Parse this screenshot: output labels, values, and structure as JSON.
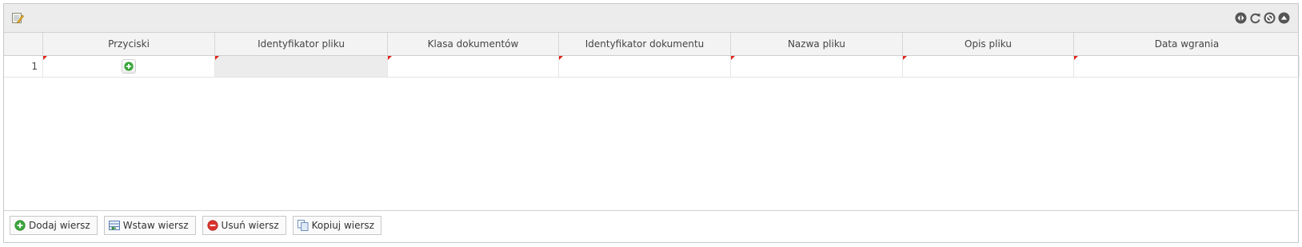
{
  "grid": {
    "columns": [
      "Przyciski",
      "Identyfikator pliku",
      "Klasa dokumentów",
      "Identyfikator dokumentu",
      "Nazwa pliku",
      "Opis pliku",
      "Data wgrania"
    ],
    "rows": [
      {
        "num": "1",
        "values": [
          "",
          "",
          "",
          "",
          "",
          "",
          ""
        ]
      }
    ]
  },
  "toolbar": {
    "add_row": "Dodaj wiersz",
    "insert_row": "Wstaw wiersz",
    "delete_row": "Usuń wiersz",
    "copy_row": "Kopiuj wiersz"
  },
  "header_tools": [
    "collapse-horizontal-icon",
    "refresh-icon",
    "cancel-icon",
    "collapse-up-icon"
  ],
  "colors": {
    "header_bg": "#ececec",
    "dirty_marker": "#e0241a",
    "add_green": "#3aa53a",
    "delete_red": "#d9332b"
  }
}
